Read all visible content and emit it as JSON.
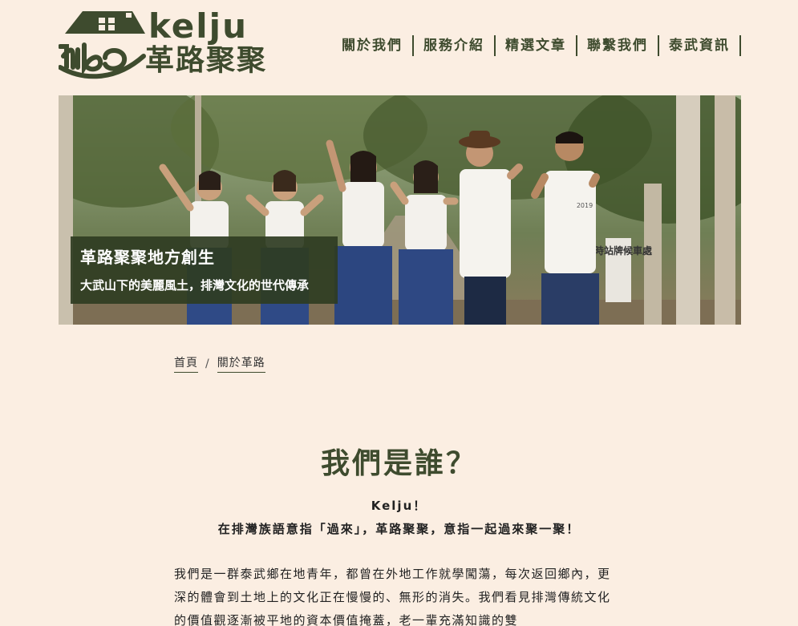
{
  "brand": {
    "wordmark": "kelju",
    "name_cjk": "革路聚聚",
    "script_mark": "Kirio"
  },
  "nav": {
    "items": [
      {
        "label": "關於我們"
      },
      {
        "label": "服務介紹"
      },
      {
        "label": "精選文章"
      },
      {
        "label": "聯繫我們"
      },
      {
        "label": "泰武資訊"
      }
    ]
  },
  "hero": {
    "title": "革路聚聚地方創生",
    "subtitle": "大武山下的美麗風土，排灣文化的世代傳承",
    "sign_text": "臨時站牌候車處",
    "shirt_text": "2019"
  },
  "breadcrumb": {
    "home": "首頁",
    "separator": "/",
    "current": "關於革路"
  },
  "section": {
    "title": "我們是誰？",
    "tagline_1": "Kelju！",
    "tagline_2": "在排灣族語意指「過來」，革路聚聚，意指一起過來聚一聚！",
    "body": "我們是一群泰武鄉在地青年，都曾在外地工作就學闖蕩，每次返回鄉內，更深的體會到土地上的文化正在慢慢的、無形的消失。我們看見排灣傳統文化的價值觀逐漸被平地的資本價值掩蓋，老一輩充滿知識的雙"
  },
  "colors": {
    "background": "#fbeee2",
    "brand_green": "#3e4b2e",
    "caption_bg": "#2f3c22"
  }
}
